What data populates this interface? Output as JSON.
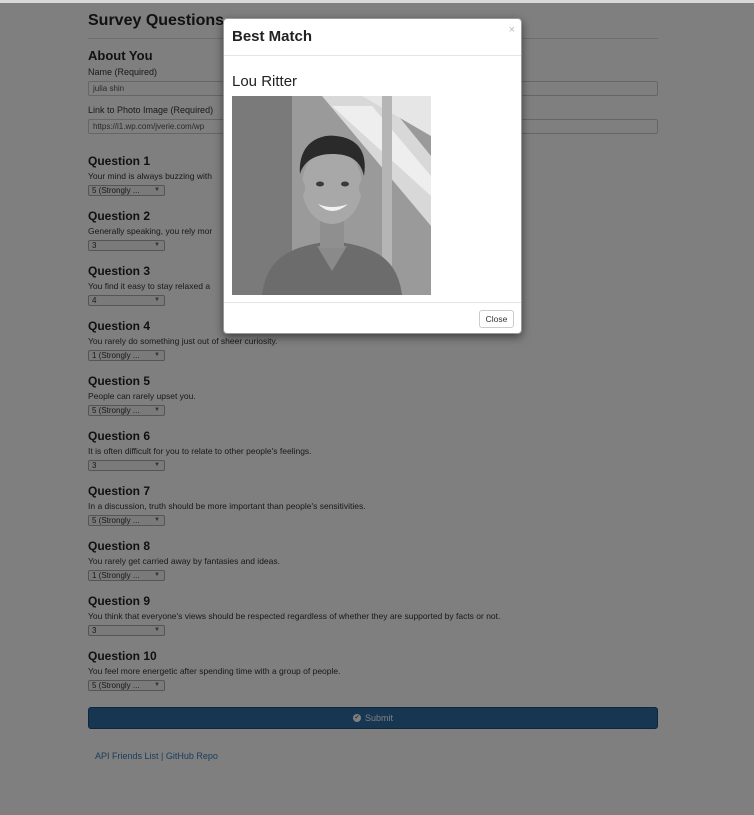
{
  "page": {
    "title": "Survey Questions",
    "about": {
      "heading": "About You",
      "name_label": "Name (Required)",
      "name_value": "julia shin",
      "photo_label": "Link to Photo Image (Required)",
      "photo_value": "https://i1.wp.com/jverie.com/wp"
    },
    "questions": [
      {
        "label": "Question 1",
        "text": "Your mind is always buzzing with",
        "selected": "5 (Strongly ..."
      },
      {
        "label": "Question 2",
        "text": "Generally speaking, you rely mor",
        "selected": "3"
      },
      {
        "label": "Question 3",
        "text": "You find it easy to stay relaxed a",
        "selected": "4"
      },
      {
        "label": "Question 4",
        "text": "You rarely do something just out of sheer curiosity.",
        "selected": "1 (Strongly ..."
      },
      {
        "label": "Question 5",
        "text": "People can rarely upset you.",
        "selected": "5 (Strongly ..."
      },
      {
        "label": "Question 6",
        "text": "It is often difficult for you to relate to other people's feelings.",
        "selected": "3"
      },
      {
        "label": "Question 7",
        "text": "In a discussion, truth should be more important than people's sensitivities.",
        "selected": "5 (Strongly ..."
      },
      {
        "label": "Question 8",
        "text": "You rarely get carried away by fantasies and ideas.",
        "selected": "1 (Strongly ..."
      },
      {
        "label": "Question 9",
        "text": "You think that everyone's views should be respected regardless of whether they are supported by facts or not.",
        "selected": "3"
      },
      {
        "label": "Question 10",
        "text": "You feel more energetic after spending time with a group of people.",
        "selected": "5 (Strongly ..."
      }
    ],
    "submit_label": "Submit",
    "footer": {
      "link1": "API Friends List",
      "separator": "|",
      "link2": "GitHub Repo"
    }
  },
  "modal": {
    "title": "Best Match",
    "close_x": "×",
    "match_name": "Lou Ritter",
    "close_label": "Close"
  },
  "colors": {
    "primary": "#2e6da4",
    "link": "#337ab7",
    "backdrop": "rgba(0,0,0,0.5)"
  }
}
